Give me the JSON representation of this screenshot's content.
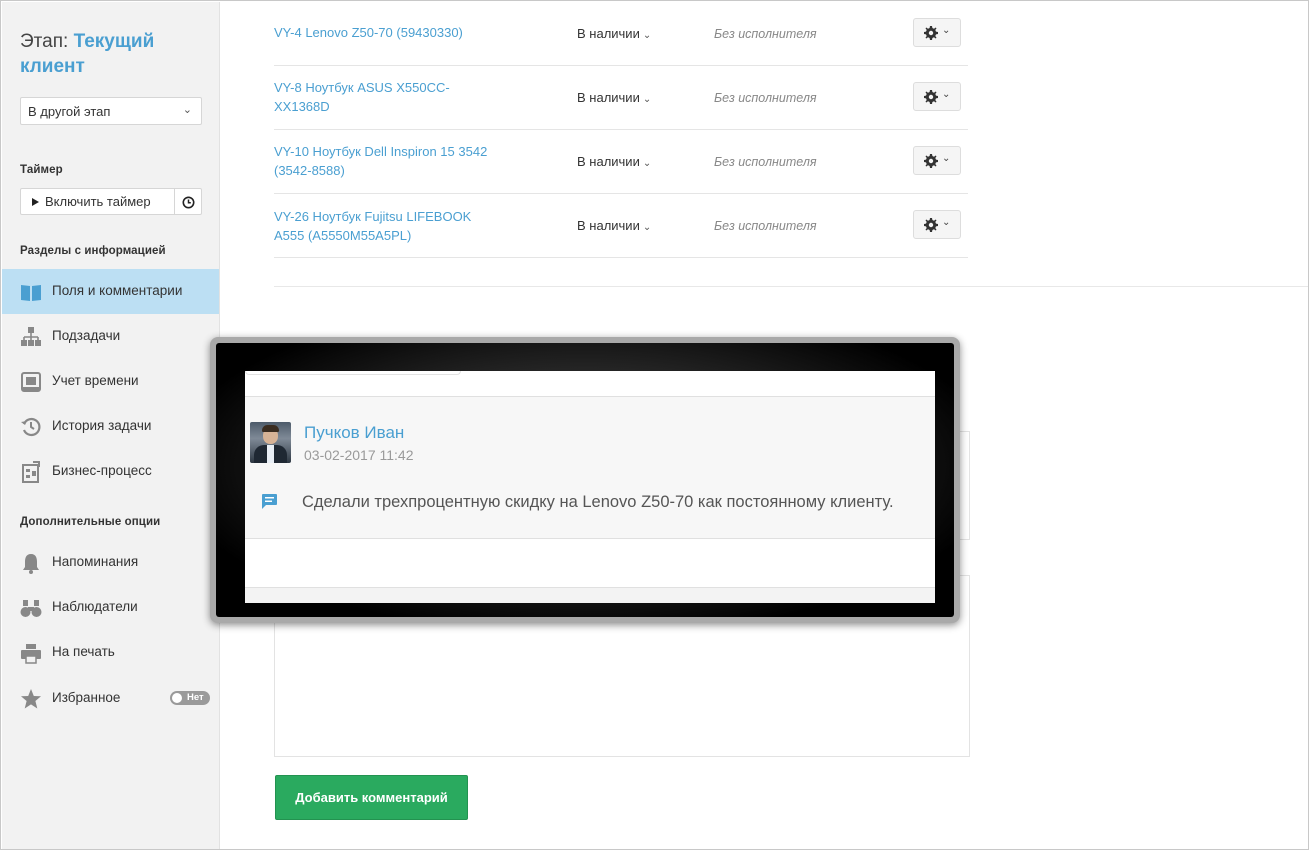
{
  "sidebar": {
    "stage_prefix": "Этап:",
    "stage_value": "Текущий клиент",
    "stage_select": "В другой этап",
    "timer_label": "Таймер",
    "timer_button": "Включить таймер",
    "info_sections_label": "Разделы с информацией",
    "info_items": [
      {
        "label": "Поля и комментарии",
        "icon": "book-icon",
        "active": true
      },
      {
        "label": "Подзадачи",
        "icon": "hierarchy-icon"
      },
      {
        "label": "Учет времени",
        "icon": "time-log-icon"
      },
      {
        "label": "История задачи",
        "icon": "history-icon"
      },
      {
        "label": "Бизнес-процесс",
        "icon": "business-process-icon"
      }
    ],
    "extra_label": "Дополнительные опции",
    "extra_items": [
      {
        "label": "Напоминания",
        "icon": "bell-icon"
      },
      {
        "label": "Наблюдатели",
        "icon": "binoculars-icon"
      },
      {
        "label": "На печать",
        "icon": "printer-icon"
      },
      {
        "label": "Избранное",
        "icon": "star-icon",
        "toggle": "Нет"
      }
    ]
  },
  "tasks": [
    {
      "name": "VY-4  Lenovo Z50-70 (59430330)",
      "status": "В наличии",
      "assignee": "Без исполнителя"
    },
    {
      "name": "VY-8  Ноутбук ASUS X550CC-XX1368D",
      "status": "В наличии",
      "assignee": "Без исполнителя"
    },
    {
      "name": "VY-10  Ноутбук Dell Inspiron 15 3542 (3542-8588)",
      "status": "В наличии",
      "assignee": "Без исполнителя"
    },
    {
      "name": "VY-26  Ноутбук Fujitsu LIFEBOOK A555 (A5550M55A5PL)",
      "status": "В наличии",
      "assignee": "Без исполнителя"
    }
  ],
  "comment": {
    "author": "Пучков Иван",
    "date": "03-02-2017 11:42",
    "text": "Сделали трехпроцентную скидку на Lenovo Z50-70 как постоянному клиенту."
  },
  "add_comment_button": "Добавить комментарий",
  "colors": {
    "accent": "#4a9fd1",
    "active_nav": "#bcdff3",
    "primary_button": "#2aaa5f",
    "sidebar_bg": "#f2f2f2"
  }
}
